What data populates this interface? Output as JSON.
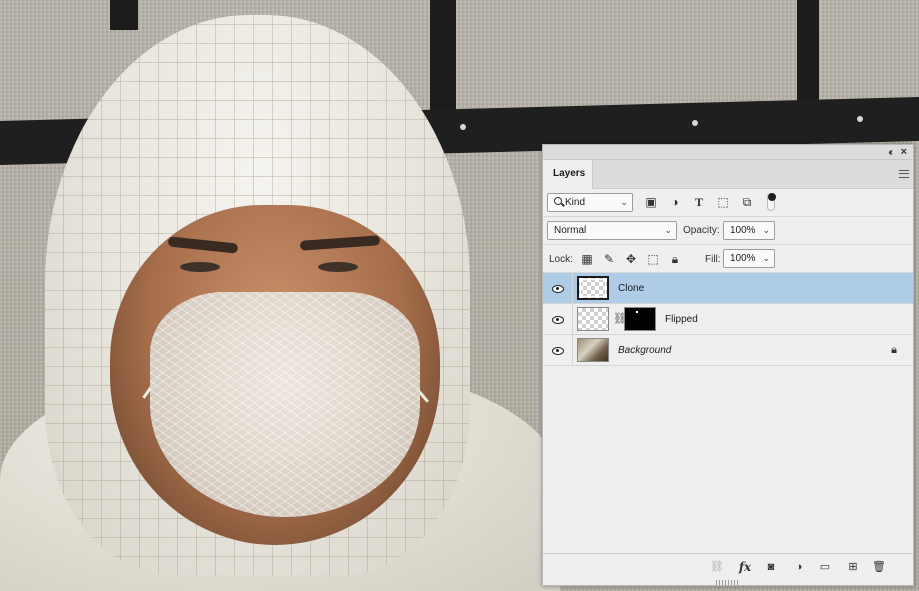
{
  "layers_panel": {
    "tab_label": "Layers",
    "filter": {
      "kind_label": "Kind",
      "icons": [
        "image-filter-icon",
        "adjustment-filter-icon",
        "type-filter-icon",
        "shape-filter-icon",
        "smart-object-filter-icon"
      ]
    },
    "blend_mode": "Normal",
    "opacity_label": "Opacity:",
    "opacity_value": "100%",
    "lock_label": "Lock:",
    "lock_icons": [
      "lock-transparent-pixels-icon",
      "lock-image-pixels-icon",
      "lock-position-icon",
      "lock-artboard-icon",
      "lock-all-icon"
    ],
    "fill_label": "Fill:",
    "fill_value": "100%",
    "layers": [
      {
        "name": "Clone",
        "selected": true,
        "visible": true
      },
      {
        "name": "Flipped",
        "selected": false,
        "visible": true,
        "has_mask": true
      },
      {
        "name": "Background",
        "selected": false,
        "visible": true,
        "locked": true
      }
    ],
    "bottom_icons": [
      "link-layers-icon",
      "fx-icon",
      "add-mask-icon",
      "new-adjustment-layer-icon",
      "new-group-icon",
      "new-layer-icon",
      "delete-layer-icon"
    ],
    "fx_label": "fx",
    "selection_color": "#aecbe8"
  }
}
